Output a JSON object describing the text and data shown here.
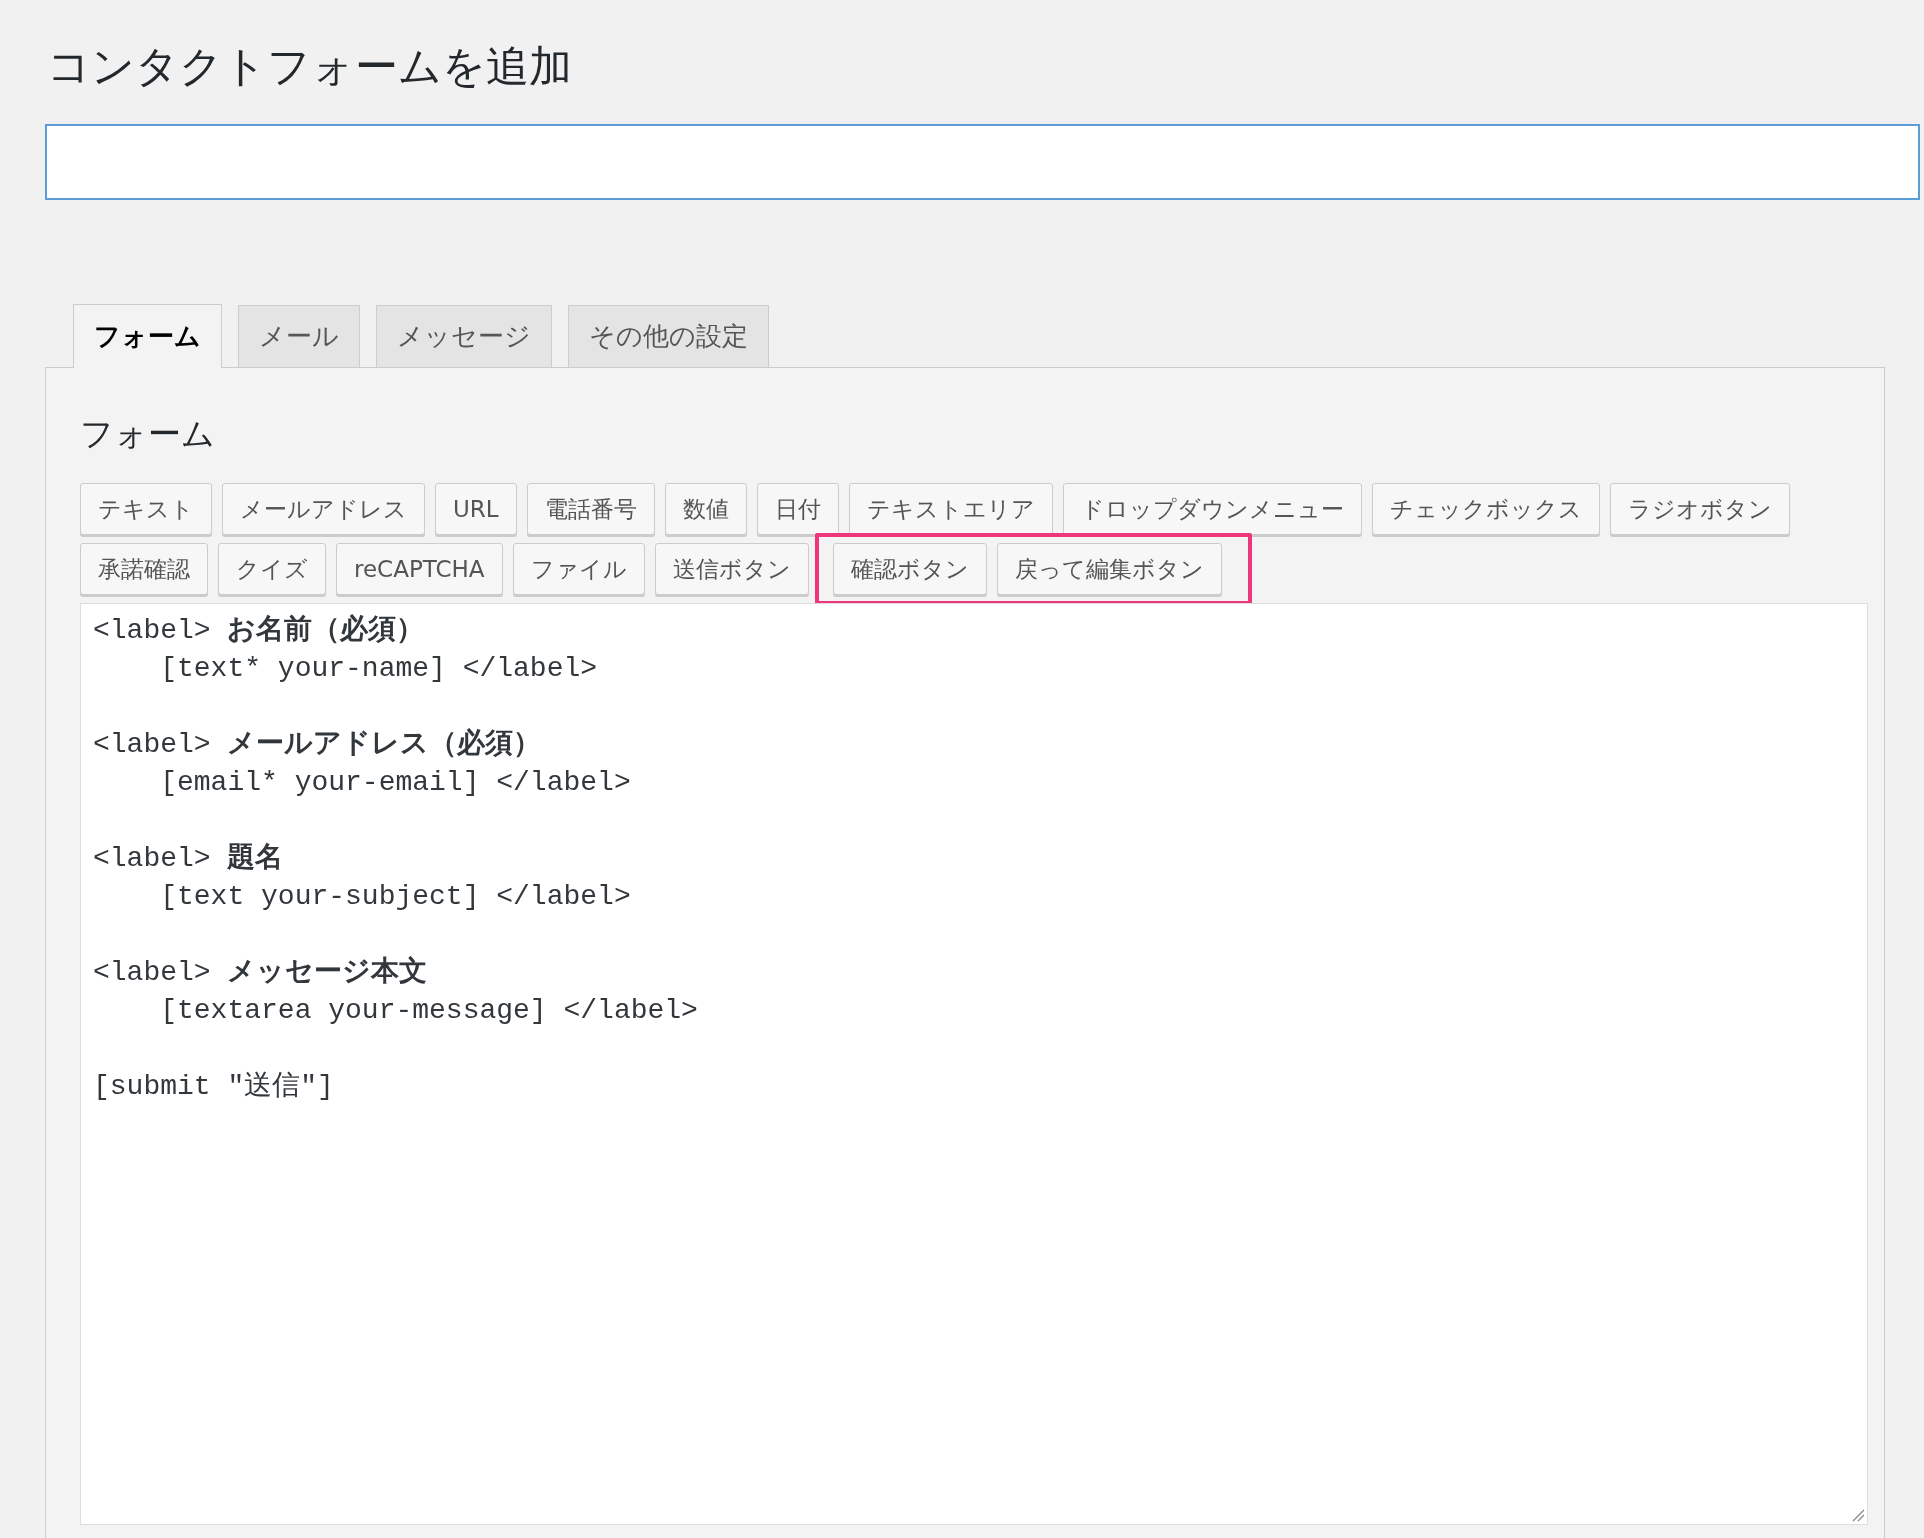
{
  "page_title": "コンタクトフォームを追加",
  "tabs": [
    {
      "label": "フォーム",
      "selected": true
    },
    {
      "label": "メール",
      "selected": false
    },
    {
      "label": "メッセージ",
      "selected": false
    },
    {
      "label": "その他の設定",
      "selected": false
    }
  ],
  "panel": {
    "heading": "フォーム",
    "tag_buttons_row_1": [
      "テキスト",
      "メールアドレス",
      "URL",
      "電話番号",
      "数値",
      "日付",
      "テキストエリア",
      "ドロップダウンメニュー",
      "チェックボックス",
      "ラジオボタン"
    ],
    "tag_buttons_row_2": [
      "承諾確認",
      "クイズ",
      "reCAPTCHA",
      "ファイル",
      "送信ボタン"
    ],
    "highlighted_buttons": [
      "確認ボタン",
      "戻って編集ボタン"
    ],
    "editor_blocks": [
      [
        "<label> **お名前（必須）**",
        "    [text* your-name] </label>"
      ],
      [
        "<label> **メールアドレス（必須）**",
        "    [email* your-email] </label>"
      ],
      [
        "<label> **題名**",
        "    [text your-subject] </label>"
      ],
      [
        "<label> **メッセージ本文**",
        "    [textarea your-message] </label>"
      ],
      [
        "[submit \"送信\"]"
      ]
    ]
  }
}
